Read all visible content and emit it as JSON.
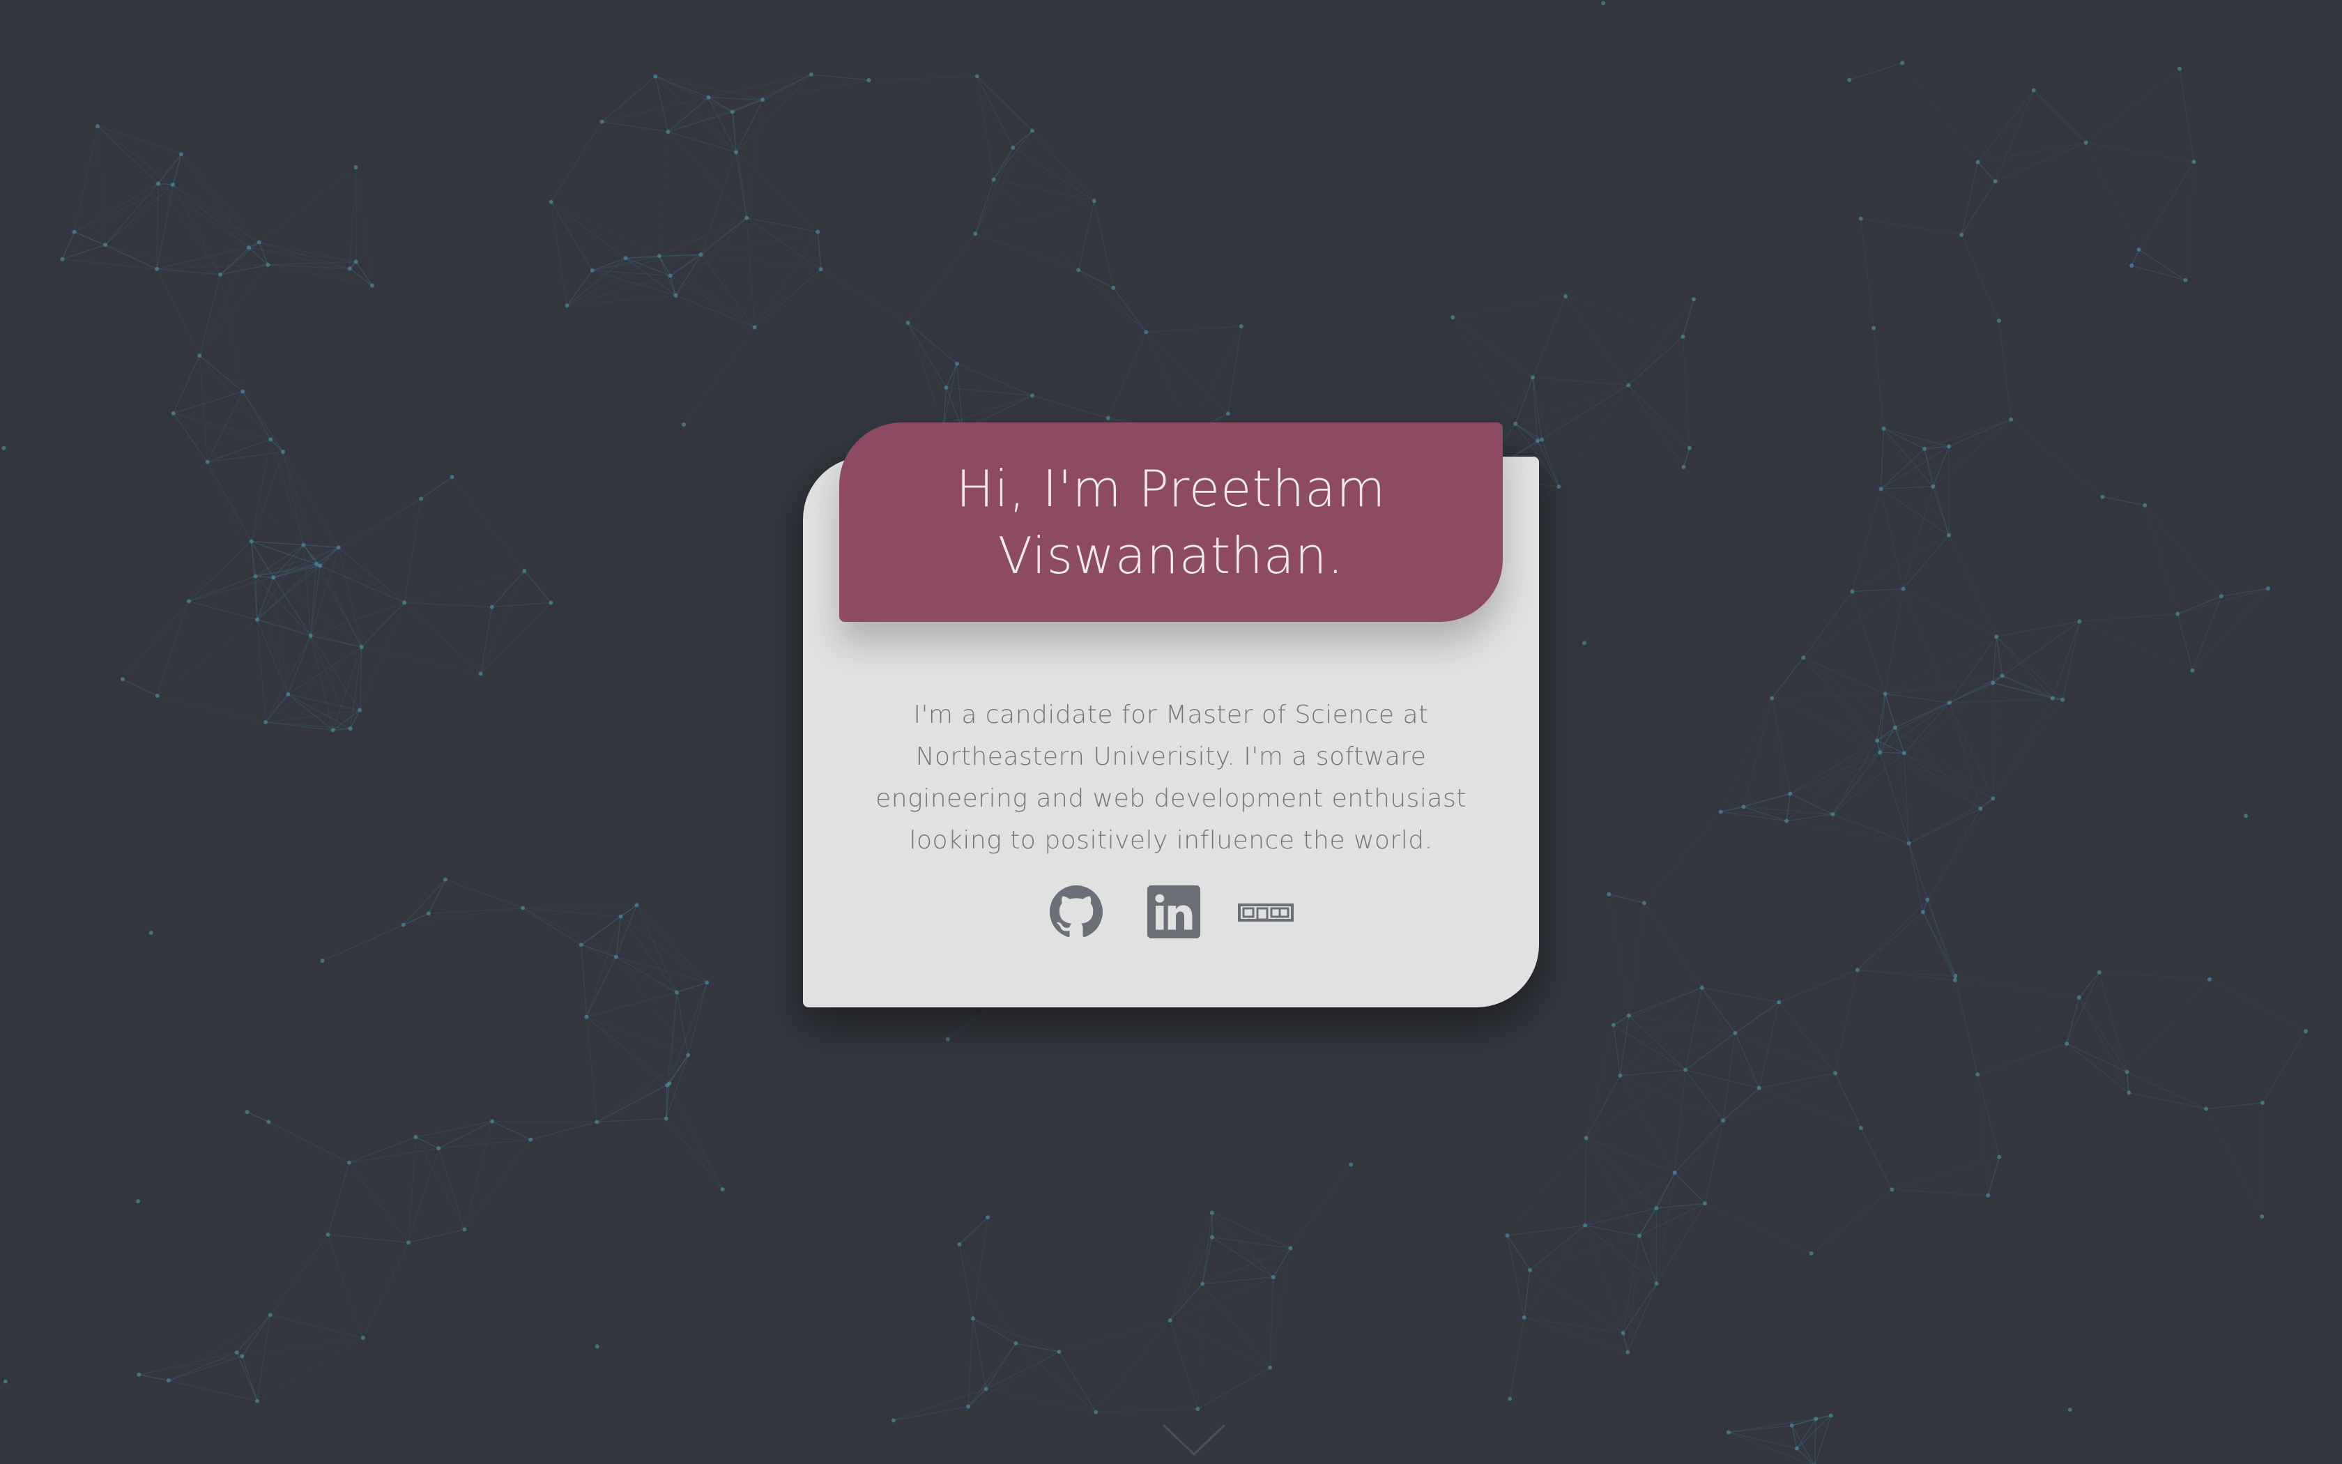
{
  "hero": {
    "title": "Hi, I'm Preetham Viswanathan.",
    "bio": "I'm a candidate for Master of Science at Northeastern Univerisity. I'm a software engineering and web development enthusiast looking to positively influence the world."
  },
  "social_links": [
    {
      "icon": "github-icon"
    },
    {
      "icon": "linkedin-icon"
    },
    {
      "icon": "npm-icon"
    }
  ],
  "colors": {
    "background": "#33363e",
    "card": "#e1e1e1",
    "banner": "#8c4b62",
    "banner_text": "#f2e9ed",
    "body_text": "#757575",
    "icon": "#6b7078",
    "network_line": "#3f6b7a",
    "network_node": "#4b8aa0"
  }
}
